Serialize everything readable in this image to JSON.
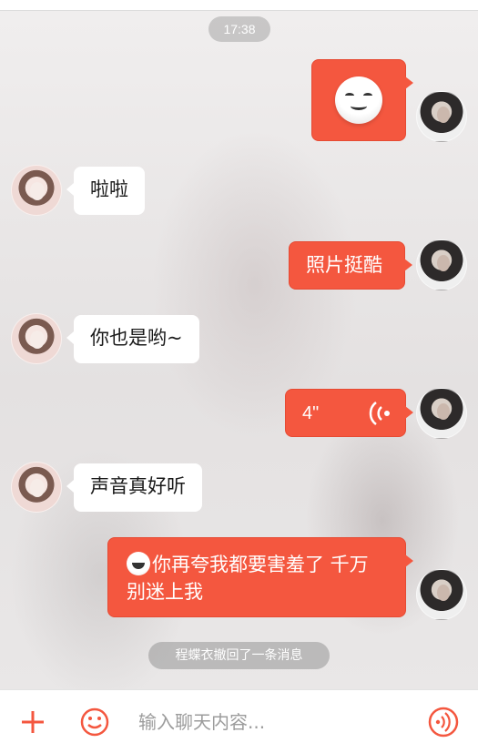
{
  "status": {
    "time": "17:38"
  },
  "messages": [
    {
      "side": "out",
      "type": "emoji",
      "emoji_name": "smile-emoji"
    },
    {
      "side": "in",
      "type": "text",
      "text": "啦啦"
    },
    {
      "side": "out",
      "type": "text",
      "text": "照片挺酷"
    },
    {
      "side": "in",
      "type": "text",
      "text": "你也是哟~"
    },
    {
      "side": "out",
      "type": "voice",
      "duration": "4\""
    },
    {
      "side": "in",
      "type": "text",
      "text": "声音真好听"
    },
    {
      "side": "out",
      "type": "text",
      "text_line1": "你再夸我都要害羞了 千万",
      "text_line2": "别迷上我",
      "emoji_name": "grin-emoji"
    }
  ],
  "system_notice": "程蝶衣撤回了一条消息",
  "input": {
    "placeholder": "输入聊天内容...",
    "icons": [
      "plus-icon",
      "emoji-icon",
      "voice-icon"
    ]
  },
  "colors": {
    "accent": "#f4573f",
    "incoming_bubble": "#ffffff",
    "pill": "#969696"
  }
}
